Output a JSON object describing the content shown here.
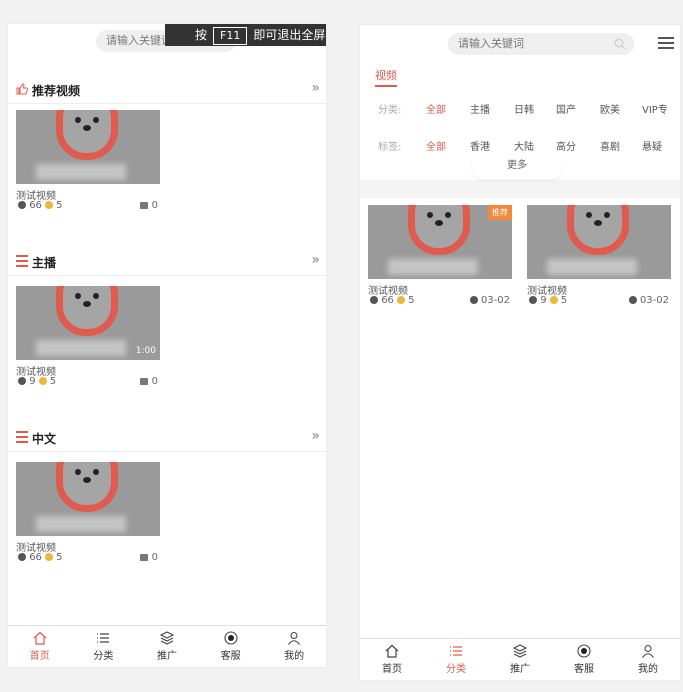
{
  "left": {
    "search_placeholder": "请输入关键词",
    "fullscreen_hint": {
      "prefix": "按",
      "key": "F11",
      "suffix": "即可退出全屏模式"
    },
    "sections": [
      {
        "title": "推荐视频",
        "icon": "thumbs-up-icon",
        "more": "»",
        "card": {
          "title": "测试视频",
          "views": "66",
          "coins": "5",
          "likes": "0",
          "duration": ""
        }
      },
      {
        "title": "主播",
        "icon": "bars-icon",
        "more": "»",
        "card": {
          "title": "测试视频",
          "views": "9",
          "coins": "5",
          "likes": "0",
          "duration": "1:00"
        }
      },
      {
        "title": "中文",
        "icon": "bars-icon",
        "more": "»",
        "card": {
          "title": "测试视频",
          "views": "66",
          "coins": "5",
          "likes": "0",
          "duration": ""
        }
      }
    ],
    "tabbar": [
      {
        "label": "首页",
        "icon": "home-icon",
        "active": true
      },
      {
        "label": "分类",
        "icon": "list-icon",
        "active": false
      },
      {
        "label": "推广",
        "icon": "layers-icon",
        "active": false
      },
      {
        "label": "客服",
        "icon": "chat-icon",
        "active": false
      },
      {
        "label": "我的",
        "icon": "user-icon",
        "active": false
      }
    ]
  },
  "right": {
    "search_placeholder": "请输入关键词",
    "tab": "视频",
    "category_label": "分类:",
    "categories": [
      "全部",
      "主播",
      "日韩",
      "国产",
      "欧美",
      "VIP专"
    ],
    "tag_label": "标签:",
    "tags": [
      "全部",
      "香港",
      "大陆",
      "高分",
      "喜剧",
      "悬疑"
    ],
    "more": "更多",
    "cards": [
      {
        "title": "测试视频",
        "views": "66",
        "coins": "5",
        "date": "03-02",
        "badge": "推荐"
      },
      {
        "title": "测试视频",
        "views": "9",
        "coins": "5",
        "date": "03-02",
        "badge": ""
      }
    ],
    "tabbar": [
      {
        "label": "首页",
        "icon": "home-icon",
        "active": false
      },
      {
        "label": "分类",
        "icon": "list-icon",
        "active": true
      },
      {
        "label": "推广",
        "icon": "layers-icon",
        "active": false
      },
      {
        "label": "客服",
        "icon": "chat-icon",
        "active": false
      },
      {
        "label": "我的",
        "icon": "user-icon",
        "active": false
      }
    ]
  },
  "colors": {
    "accent": "#e05a4e",
    "badge": "#f08a3a",
    "coin": "#e8b93a"
  }
}
